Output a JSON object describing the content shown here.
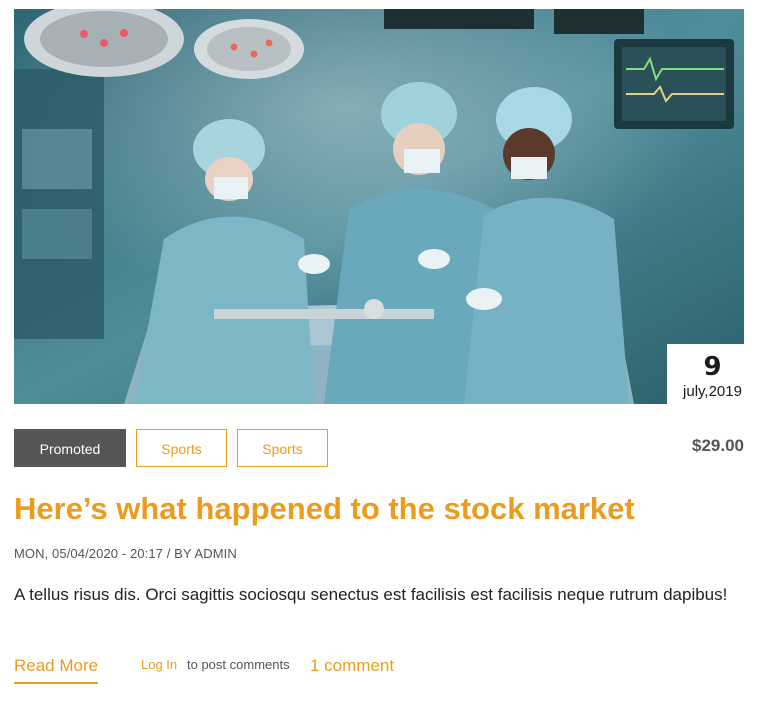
{
  "article": {
    "image_description": "",
    "date": {
      "day": "9",
      "month_year": "july,2019"
    },
    "tags": [
      "Promoted",
      "Sports",
      "Sports"
    ],
    "price": "$29.00",
    "title": "Here’s what happened to the stock market",
    "meta": "MON, 05/04/2020 - 20:17 / BY ADMIN",
    "body": "A tellus risus dis. Orci sagittis sociosqu senectus est facilisis est facilisis neque rutrum dapibus!",
    "read_more": "Read More",
    "login_link": "Log In",
    "login_suffix": "to post comments",
    "comments": "1 comment"
  },
  "colors": {
    "accent": "#ec9c1d",
    "tag_active_bg": "#555555",
    "text": "#222222",
    "meta": "#555555"
  },
  "icons": []
}
